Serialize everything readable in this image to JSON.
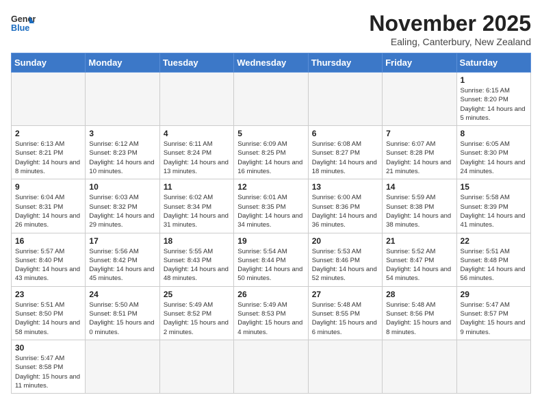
{
  "header": {
    "logo_general": "General",
    "logo_blue": "Blue",
    "month_title": "November 2025",
    "location": "Ealing, Canterbury, New Zealand"
  },
  "weekdays": [
    "Sunday",
    "Monday",
    "Tuesday",
    "Wednesday",
    "Thursday",
    "Friday",
    "Saturday"
  ],
  "weeks": [
    [
      {
        "day": "",
        "info": ""
      },
      {
        "day": "",
        "info": ""
      },
      {
        "day": "",
        "info": ""
      },
      {
        "day": "",
        "info": ""
      },
      {
        "day": "",
        "info": ""
      },
      {
        "day": "",
        "info": ""
      },
      {
        "day": "1",
        "info": "Sunrise: 6:15 AM\nSunset: 8:20 PM\nDaylight: 14 hours and 5 minutes."
      }
    ],
    [
      {
        "day": "2",
        "info": "Sunrise: 6:13 AM\nSunset: 8:21 PM\nDaylight: 14 hours and 8 minutes."
      },
      {
        "day": "3",
        "info": "Sunrise: 6:12 AM\nSunset: 8:23 PM\nDaylight: 14 hours and 10 minutes."
      },
      {
        "day": "4",
        "info": "Sunrise: 6:11 AM\nSunset: 8:24 PM\nDaylight: 14 hours and 13 minutes."
      },
      {
        "day": "5",
        "info": "Sunrise: 6:09 AM\nSunset: 8:25 PM\nDaylight: 14 hours and 16 minutes."
      },
      {
        "day": "6",
        "info": "Sunrise: 6:08 AM\nSunset: 8:27 PM\nDaylight: 14 hours and 18 minutes."
      },
      {
        "day": "7",
        "info": "Sunrise: 6:07 AM\nSunset: 8:28 PM\nDaylight: 14 hours and 21 minutes."
      },
      {
        "day": "8",
        "info": "Sunrise: 6:05 AM\nSunset: 8:30 PM\nDaylight: 14 hours and 24 minutes."
      }
    ],
    [
      {
        "day": "9",
        "info": "Sunrise: 6:04 AM\nSunset: 8:31 PM\nDaylight: 14 hours and 26 minutes."
      },
      {
        "day": "10",
        "info": "Sunrise: 6:03 AM\nSunset: 8:32 PM\nDaylight: 14 hours and 29 minutes."
      },
      {
        "day": "11",
        "info": "Sunrise: 6:02 AM\nSunset: 8:34 PM\nDaylight: 14 hours and 31 minutes."
      },
      {
        "day": "12",
        "info": "Sunrise: 6:01 AM\nSunset: 8:35 PM\nDaylight: 14 hours and 34 minutes."
      },
      {
        "day": "13",
        "info": "Sunrise: 6:00 AM\nSunset: 8:36 PM\nDaylight: 14 hours and 36 minutes."
      },
      {
        "day": "14",
        "info": "Sunrise: 5:59 AM\nSunset: 8:38 PM\nDaylight: 14 hours and 38 minutes."
      },
      {
        "day": "15",
        "info": "Sunrise: 5:58 AM\nSunset: 8:39 PM\nDaylight: 14 hours and 41 minutes."
      }
    ],
    [
      {
        "day": "16",
        "info": "Sunrise: 5:57 AM\nSunset: 8:40 PM\nDaylight: 14 hours and 43 minutes."
      },
      {
        "day": "17",
        "info": "Sunrise: 5:56 AM\nSunset: 8:42 PM\nDaylight: 14 hours and 45 minutes."
      },
      {
        "day": "18",
        "info": "Sunrise: 5:55 AM\nSunset: 8:43 PM\nDaylight: 14 hours and 48 minutes."
      },
      {
        "day": "19",
        "info": "Sunrise: 5:54 AM\nSunset: 8:44 PM\nDaylight: 14 hours and 50 minutes."
      },
      {
        "day": "20",
        "info": "Sunrise: 5:53 AM\nSunset: 8:46 PM\nDaylight: 14 hours and 52 minutes."
      },
      {
        "day": "21",
        "info": "Sunrise: 5:52 AM\nSunset: 8:47 PM\nDaylight: 14 hours and 54 minutes."
      },
      {
        "day": "22",
        "info": "Sunrise: 5:51 AM\nSunset: 8:48 PM\nDaylight: 14 hours and 56 minutes."
      }
    ],
    [
      {
        "day": "23",
        "info": "Sunrise: 5:51 AM\nSunset: 8:50 PM\nDaylight: 14 hours and 58 minutes."
      },
      {
        "day": "24",
        "info": "Sunrise: 5:50 AM\nSunset: 8:51 PM\nDaylight: 15 hours and 0 minutes."
      },
      {
        "day": "25",
        "info": "Sunrise: 5:49 AM\nSunset: 8:52 PM\nDaylight: 15 hours and 2 minutes."
      },
      {
        "day": "26",
        "info": "Sunrise: 5:49 AM\nSunset: 8:53 PM\nDaylight: 15 hours and 4 minutes."
      },
      {
        "day": "27",
        "info": "Sunrise: 5:48 AM\nSunset: 8:55 PM\nDaylight: 15 hours and 6 minutes."
      },
      {
        "day": "28",
        "info": "Sunrise: 5:48 AM\nSunset: 8:56 PM\nDaylight: 15 hours and 8 minutes."
      },
      {
        "day": "29",
        "info": "Sunrise: 5:47 AM\nSunset: 8:57 PM\nDaylight: 15 hours and 9 minutes."
      }
    ],
    [
      {
        "day": "30",
        "info": "Sunrise: 5:47 AM\nSunset: 8:58 PM\nDaylight: 15 hours and 11 minutes."
      },
      {
        "day": "",
        "info": ""
      },
      {
        "day": "",
        "info": ""
      },
      {
        "day": "",
        "info": ""
      },
      {
        "day": "",
        "info": ""
      },
      {
        "day": "",
        "info": ""
      },
      {
        "day": "",
        "info": ""
      }
    ]
  ]
}
